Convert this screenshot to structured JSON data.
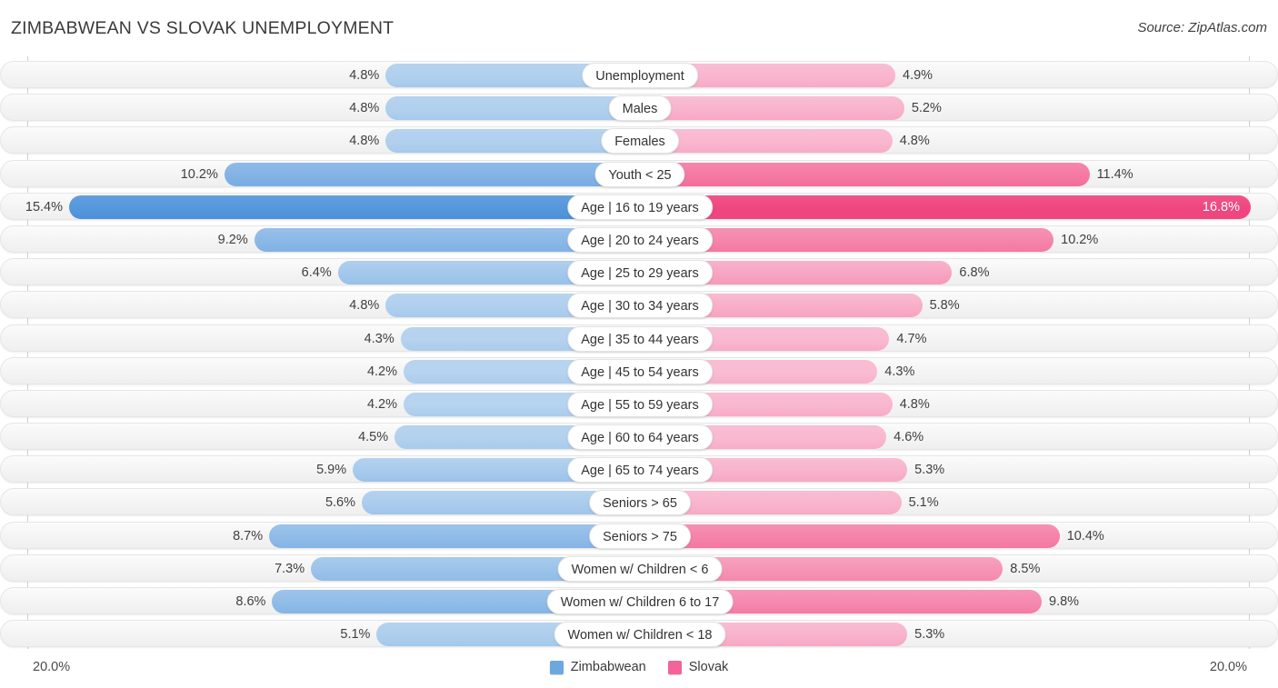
{
  "header": {
    "title": "ZIMBABWEAN VS SLOVAK UNEMPLOYMENT",
    "source": "Source: ZipAtlas.com"
  },
  "axis": {
    "left_max_label": "20.0%",
    "right_max_label": "20.0%",
    "max_value": 20.0
  },
  "legend": {
    "items": [
      {
        "label": "Zimbabwean",
        "color": "#6aa8dd"
      },
      {
        "label": "Slovak",
        "color": "#f2649a"
      }
    ]
  },
  "colors": {
    "left_light": "#b6d3ef",
    "left_dark": "#4a90d9",
    "right_light": "#f9bdd3",
    "right_dark": "#f0467f",
    "row_background": "#f4f4f4",
    "axis_line": "#d0d0d0"
  },
  "chart_data": {
    "type": "bar",
    "title": "ZIMBABWEAN VS SLOVAK UNEMPLOYMENT",
    "subtitle": "",
    "orientation": "horizontal-diverging",
    "xlabel": "",
    "ylabel": "",
    "xlim": [
      20.0,
      20.0
    ],
    "grid": false,
    "legend_position": "bottom-center",
    "categories": [
      "Unemployment",
      "Males",
      "Females",
      "Youth < 25",
      "Age | 16 to 19 years",
      "Age | 20 to 24 years",
      "Age | 25 to 29 years",
      "Age | 30 to 34 years",
      "Age | 35 to 44 years",
      "Age | 45 to 54 years",
      "Age | 55 to 59 years",
      "Age | 60 to 64 years",
      "Age | 65 to 74 years",
      "Seniors > 65",
      "Seniors > 75",
      "Women w/ Children < 6",
      "Women w/ Children 6 to 17",
      "Women w/ Children < 18"
    ],
    "series": [
      {
        "name": "Zimbabwean",
        "side": "left",
        "values": [
          4.8,
          4.8,
          4.8,
          10.2,
          15.4,
          9.2,
          6.4,
          4.8,
          4.3,
          4.2,
          4.2,
          4.5,
          5.9,
          5.6,
          8.7,
          7.3,
          8.6,
          5.1
        ],
        "labels": [
          "4.8%",
          "4.8%",
          "4.8%",
          "10.2%",
          "15.4%",
          "9.2%",
          "6.4%",
          "4.8%",
          "4.3%",
          "4.2%",
          "4.2%",
          "4.5%",
          "5.9%",
          "5.6%",
          "8.7%",
          "7.3%",
          "8.6%",
          "5.1%"
        ]
      },
      {
        "name": "Slovak",
        "side": "right",
        "values": [
          4.9,
          5.2,
          4.8,
          11.4,
          16.8,
          10.2,
          6.8,
          5.8,
          4.7,
          4.3,
          4.8,
          4.6,
          5.3,
          5.1,
          10.4,
          8.5,
          9.8,
          5.3
        ],
        "labels": [
          "4.9%",
          "5.2%",
          "4.8%",
          "11.4%",
          "16.8%",
          "10.2%",
          "6.8%",
          "5.8%",
          "4.7%",
          "4.3%",
          "4.8%",
          "4.6%",
          "5.3%",
          "5.1%",
          "10.4%",
          "8.5%",
          "9.8%",
          "5.3%"
        ]
      }
    ]
  }
}
